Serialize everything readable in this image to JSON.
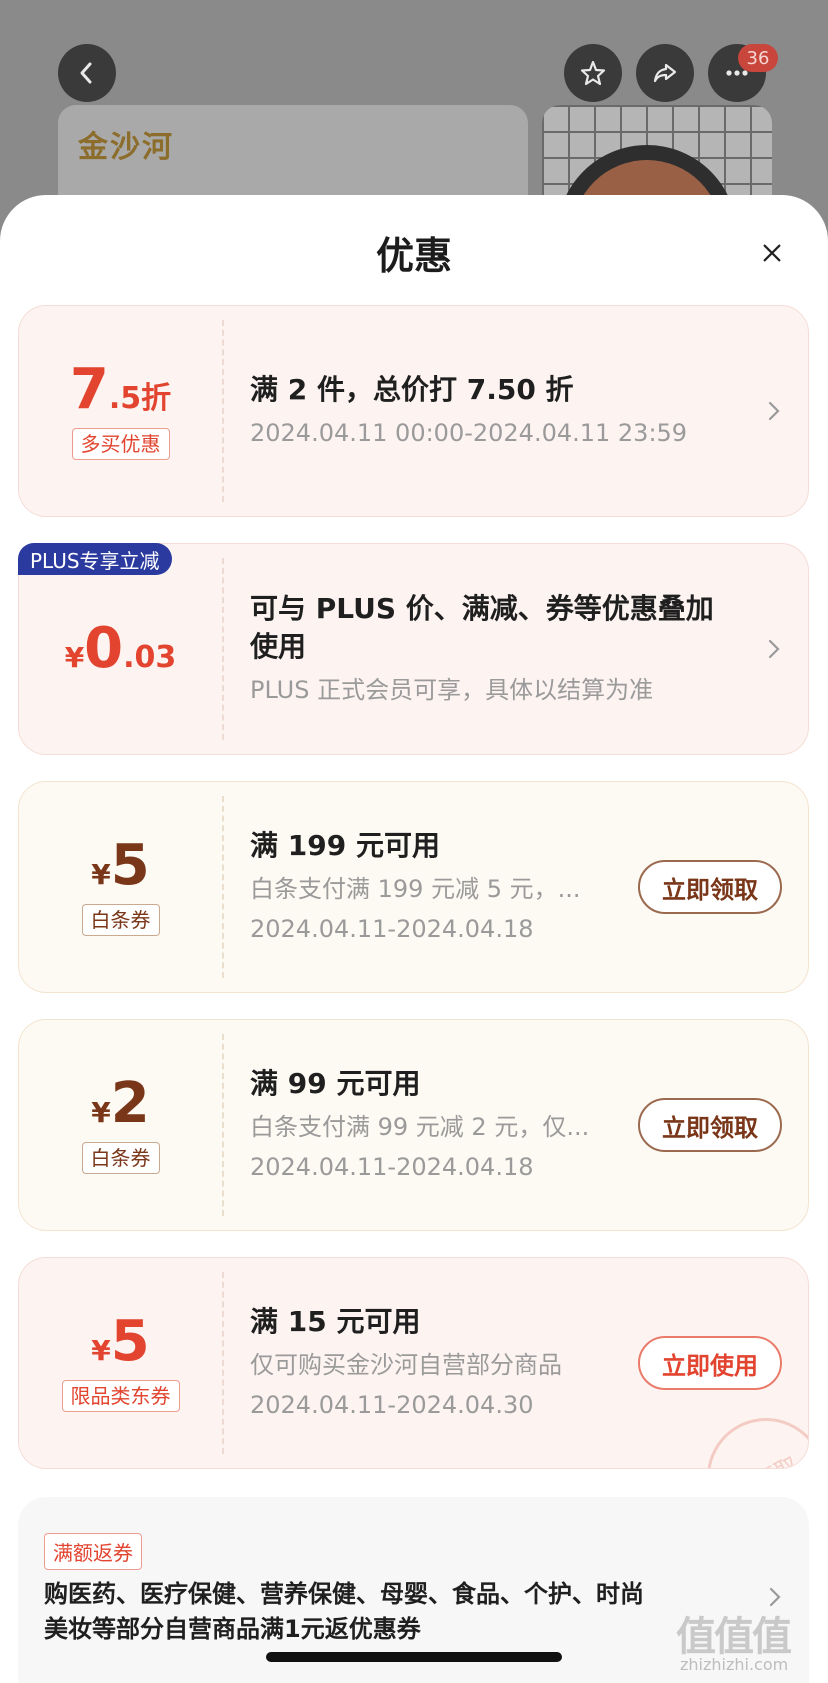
{
  "background": {
    "brand_text": "金沙河",
    "notification_count": "36"
  },
  "sheet": {
    "title": "优惠"
  },
  "promos": [
    {
      "amount_big": "7",
      "amount_small": ".5折",
      "tag": "多买优惠",
      "main": "满 2 件，总价打 7.50 折",
      "sub": "2024.04.11 00:00-2024.04.11 23:59"
    },
    {
      "badge": "PLUS专享立减",
      "currency": "¥",
      "amount_big": "0",
      "amount_small": ".03",
      "main_line1": "可与 PLUS 价、满减、券等优惠叠加",
      "main_line2": "使用",
      "sub": "PLUS 正式会员可享，具体以结算为准"
    },
    {
      "currency": "¥",
      "amount_big": "5",
      "tag": "白条券",
      "main": "满 199 元可用",
      "sub1": "白条支付满 199 元减 5 元，...",
      "sub2": "2024.04.11-2024.04.18",
      "button": "立即领取"
    },
    {
      "currency": "¥",
      "amount_big": "2",
      "tag": "白条券",
      "main": "满 99 元可用",
      "sub1": "白条支付满 99 元减 2 元，仅...",
      "sub2": "2024.04.11-2024.04.18",
      "button": "立即领取"
    },
    {
      "currency": "¥",
      "amount_big": "5",
      "tag": "限品类东券",
      "main": "满 15 元可用",
      "sub1": "仅可购买金沙河自营部分商品",
      "sub2": "2024.04.11-2024.04.30",
      "button": "立即使用",
      "stamp": "已领取"
    }
  ],
  "rebate": {
    "tag": "满额返券",
    "text": "购医药、医疗保健、营养保健、母婴、食品、个护、时尚美妆等部分自营商品满1元返优惠券"
  },
  "watermark": {
    "logo": "值值值",
    "url": "zhizhizhi.com"
  },
  "colors": {
    "accent_red": "#e2442f",
    "coupon_brown": "#7a3618",
    "plus_blue": "#2b3a9e"
  }
}
